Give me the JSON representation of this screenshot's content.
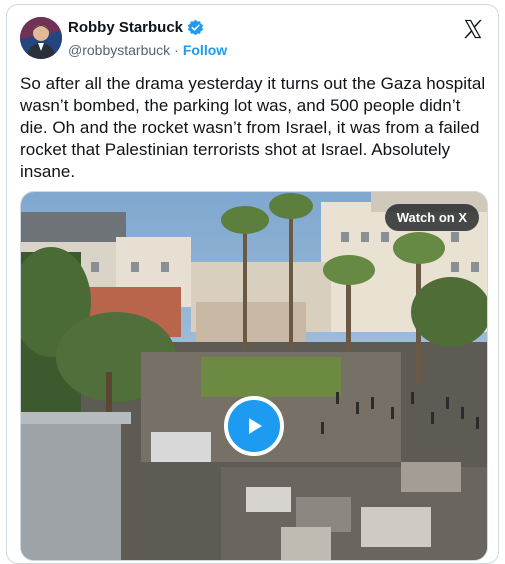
{
  "tweet": {
    "author_name": "Robby Starbuck",
    "handle": "@robbystarbuck",
    "separator": "·",
    "follow_label": "Follow",
    "text": "So after all the drama yesterday it turns out the Gaza hospital wasn’t bombed, the parking lot was, and 500 people didn’t die. Oh and the rocket wasn’t from Israel, it was from a failed rocket that Palestinian terrorists shot at Israel. Absolutely insane."
  },
  "media": {
    "watch_label": "Watch on X",
    "play_icon": "play-icon"
  },
  "icons": {
    "verified": "verified-badge-icon",
    "logo": "x-logo-icon"
  },
  "colors": {
    "accent": "#1d9bf0",
    "text": "#0f1419",
    "muted": "#536471",
    "border": "#cfd9de"
  }
}
